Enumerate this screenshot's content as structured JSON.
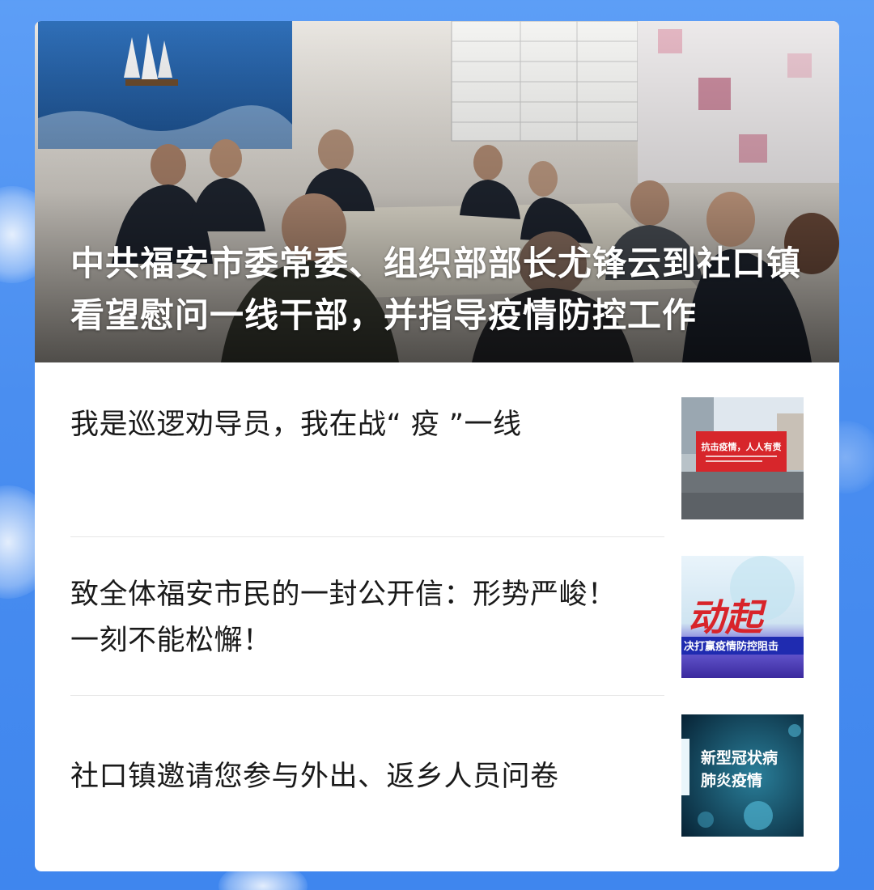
{
  "hero": {
    "title": "中共福安市委常委、组织部部长尤锋云到社口镇看望慰问一线干部，并指导疫情防控工作"
  },
  "items": [
    {
      "title": "我是巡逻劝导员，我在战“ 疫 ”一线",
      "thumb_banner": "抗击疫情，人人有责"
    },
    {
      "title": "致全体福安市民的一封公开信：形势严峻！一刻不能松懈！",
      "thumb_big": "动起",
      "thumb_sub": "决打赢疫情防控阻击"
    },
    {
      "title": "社口镇邀请您参与外出、返乡人员问卷",
      "thumb_line1": "新型冠状病",
      "thumb_line2": "肺炎疫情"
    }
  ],
  "colors": {
    "page_background": "#4a8ef0",
    "card_background": "#ffffff",
    "title_text": "#1a1a1a",
    "divider": "#e6e6e6"
  }
}
